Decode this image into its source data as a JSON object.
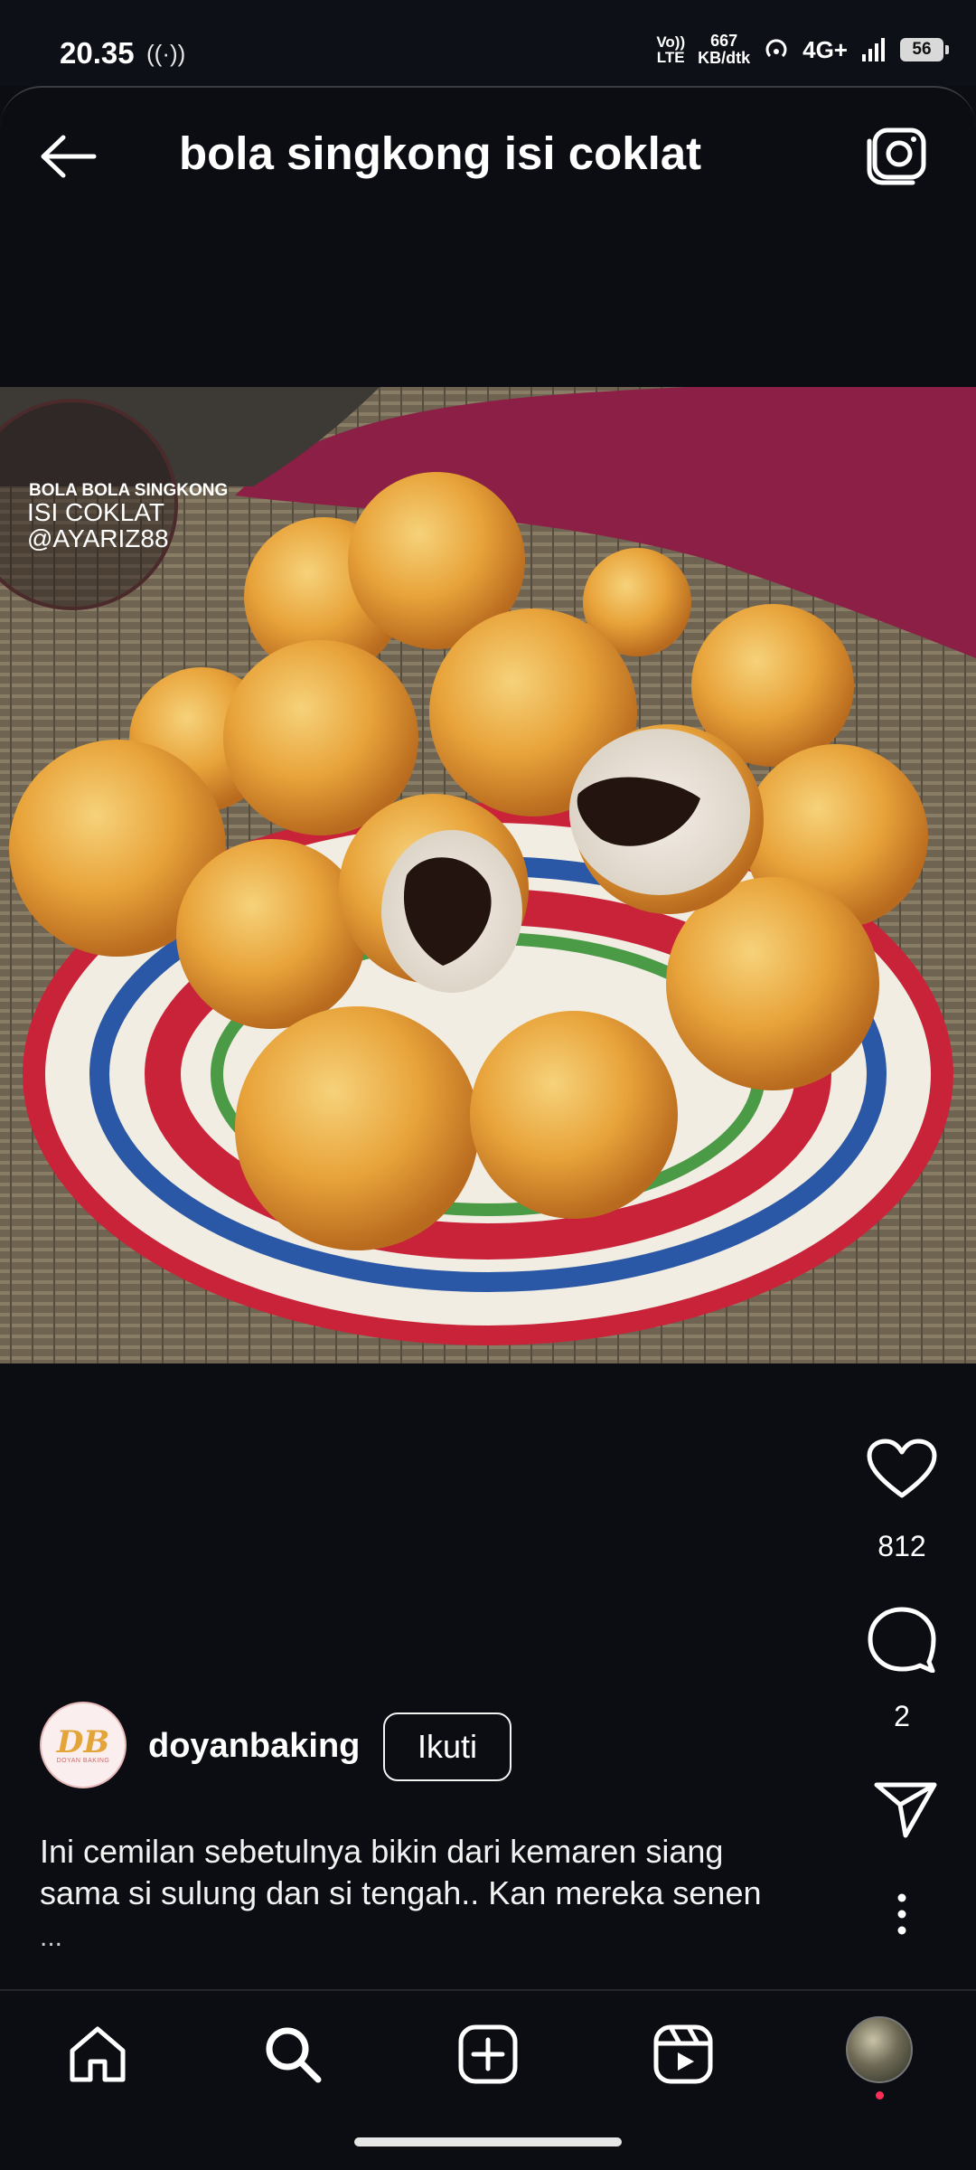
{
  "status_bar": {
    "time": "20.35",
    "hotspot_indicator": "((·))",
    "volte": [
      "Vo))",
      "LTE"
    ],
    "speed_value": "667",
    "speed_unit": "KB/dtk",
    "network": "4G+",
    "battery": "56"
  },
  "header": {
    "title": "bola singkong isi coklat",
    "back_icon": "arrow-left-icon",
    "camera_icon": "camera-icon"
  },
  "post": {
    "image_overlay": {
      "line1": "BOLA BOLA SINGKONG",
      "line2": "ISI COKLAT",
      "line3": "@AYARIZ88"
    },
    "likes": "812",
    "comments": "2",
    "author": {
      "avatar_initials": "DB",
      "avatar_subtext": "DOYAN BAKING",
      "username": "doyanbaking",
      "follow_label": "Ikuti"
    },
    "caption_lines": [
      "Ini cemilan sebetulnya bikin dari kemaren siang",
      "sama si sulung dan si tengah.. Kan mereka senen"
    ],
    "caption_more": "..."
  },
  "colors": {
    "background": "#0b0d12",
    "notification_dot": "#ff2d55"
  },
  "bottom_nav": [
    "home-icon",
    "search-icon",
    "create-icon",
    "reels-icon",
    "profile-avatar"
  ]
}
